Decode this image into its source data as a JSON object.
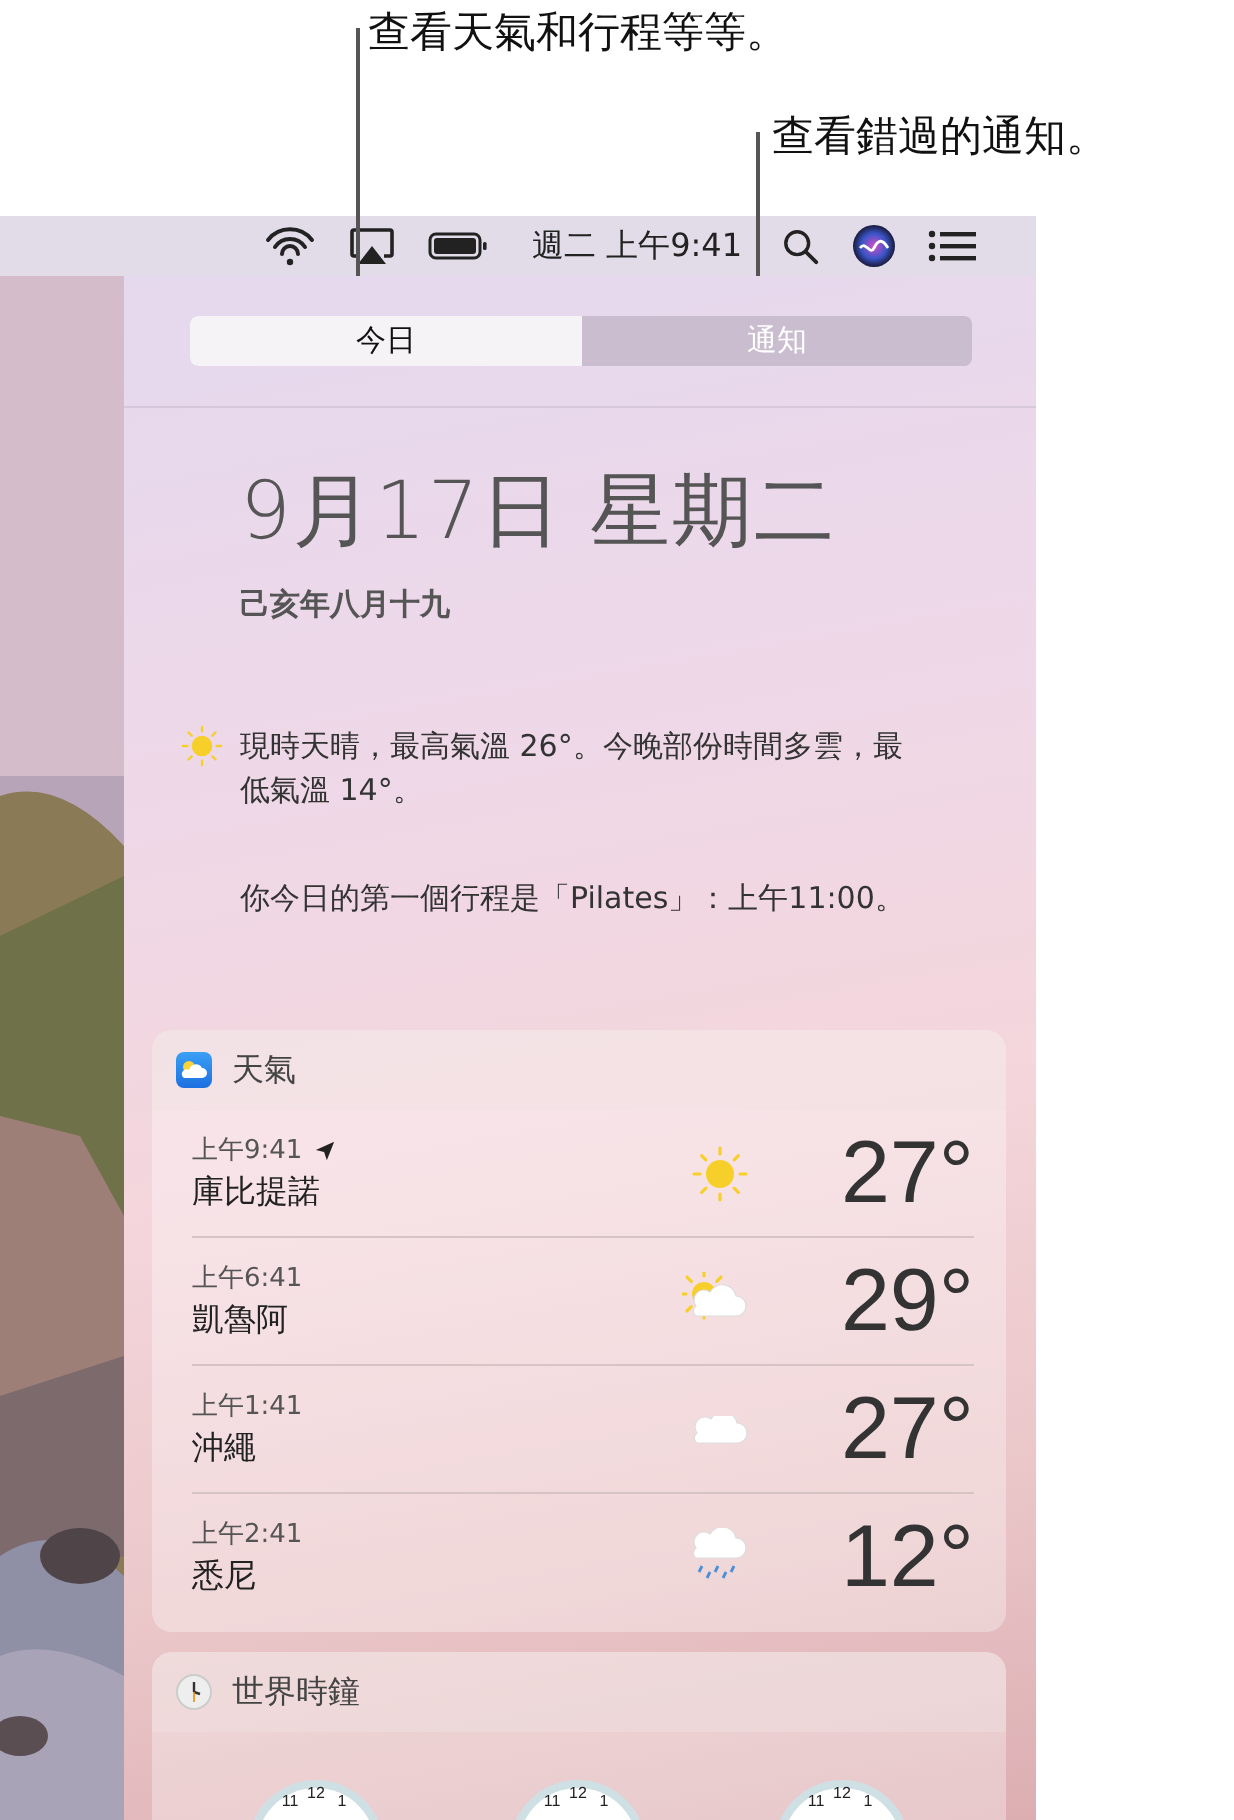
{
  "callouts": [
    {
      "text": "查看天氣和行程等等。"
    },
    {
      "text": "查看錯過的通知。"
    }
  ],
  "menu_bar": {
    "clock": "週二 上午9:41"
  },
  "tabs": [
    {
      "label": "今日",
      "selected": true
    },
    {
      "label": "通知",
      "selected": false
    }
  ],
  "today": {
    "date": "9月17日 星期二",
    "lunar_date": "己亥年八月十九",
    "weather_summary": "現時天晴，最高氣溫 26°。今晚部份時間多雲，最低氣溫 14°。",
    "schedule": "你今日的第一個行程是「Pilates」：上午11:00。"
  },
  "weather": {
    "title": "天氣",
    "rows": [
      {
        "time": "上午9:41",
        "current_location": true,
        "city": "庫比提諾",
        "kind": "sunny",
        "temp": "27°"
      },
      {
        "time": "上午6:41",
        "current_location": false,
        "city": "凱魯阿",
        "kind": "partly-cloudy",
        "temp": "29°"
      },
      {
        "time": "上午1:41",
        "current_location": false,
        "city": "沖繩",
        "kind": "cloudy",
        "temp": "27°"
      },
      {
        "time": "上午2:41",
        "current_location": false,
        "city": "悉尼",
        "kind": "rain",
        "temp": "12°"
      }
    ]
  },
  "world_clock": {
    "title": "世界時鐘",
    "clocks": [
      {
        "numerals": [
          "11",
          "12",
          "1"
        ]
      },
      {
        "numerals": [
          "11",
          "12",
          "1"
        ]
      },
      {
        "numerals": [
          "11",
          "12",
          "1"
        ]
      }
    ]
  }
}
